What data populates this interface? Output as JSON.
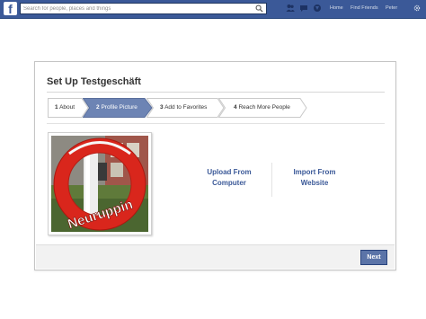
{
  "topbar": {
    "logo": "f",
    "search_placeholder": "Search for people, places and things",
    "links": [
      "Home",
      "Find Friends",
      "Peter"
    ],
    "icons": [
      "friend-requests-icon",
      "messages-icon",
      "notifications-icon",
      "gear-icon"
    ]
  },
  "setup": {
    "title": "Set Up Testgeschäft",
    "steps": [
      {
        "num": "1",
        "label": "About",
        "active": false
      },
      {
        "num": "2",
        "label": "Profile Picture",
        "active": true
      },
      {
        "num": "3",
        "label": "Add to Favorites",
        "active": false
      },
      {
        "num": "4",
        "label": "Reach More People",
        "active": false
      }
    ],
    "photo_text": "Neuruppin",
    "upload_label_1": "Upload From",
    "upload_label_2": "Computer",
    "import_label_1": "Import From",
    "import_label_2": "Website",
    "next_label": "Next"
  },
  "colors": {
    "brand": "#3b5998",
    "active_step": "#6d84b4",
    "next_button": "#5b74a8"
  }
}
